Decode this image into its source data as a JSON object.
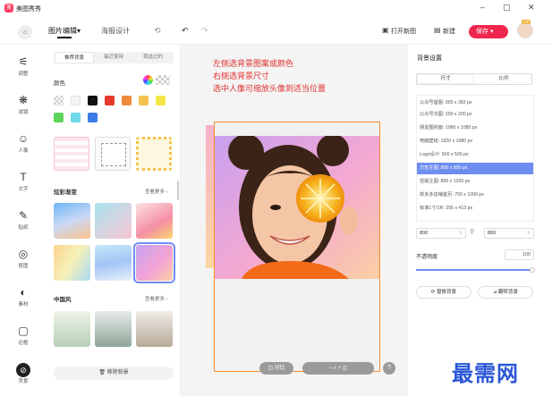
{
  "titlebar": {
    "logo_text": "美",
    "app_title": "美图秀秀",
    "min": "–",
    "max": "▢",
    "close": "✕"
  },
  "toolbar": {
    "home_icon": "⌂",
    "tab_main": "图片编辑▾",
    "tab_poster": "海报设计",
    "history_icon": "⟲",
    "undo_icon": "↶",
    "redo_icon": "↷",
    "open_label": "打开新图",
    "open_icon": "▣",
    "new_label": "新建",
    "new_icon": "▤",
    "save_label": "保存 ▾",
    "vip_badge": "VIP"
  },
  "leftnav": [
    {
      "icon": "⚟",
      "label": "调整"
    },
    {
      "icon": "❋",
      "label": "滤镜"
    },
    {
      "icon": "☺",
      "label": "人像"
    },
    {
      "icon": "T",
      "label": "文字"
    },
    {
      "icon": "✎",
      "label": "贴纸"
    },
    {
      "icon": "◎",
      "label": "抠图"
    },
    {
      "icon": "◐",
      "label": "素材"
    },
    {
      "icon": "▢",
      "label": "边框"
    },
    {
      "icon": "⊘",
      "label": "背景"
    }
  ],
  "panel": {
    "tabs": [
      "推荐背景",
      "最近使用",
      "我选过的"
    ],
    "color_label": "颜色",
    "colors": [
      "#cccccc",
      "#f4f4f4",
      "#111111",
      "#e83a2c",
      "#ef8a3a",
      "#f6c24e",
      "#f5e74a",
      "#5fd35b",
      "#6fd8e9",
      "#3d7ae6"
    ],
    "gradient_title": "炫彩渐变",
    "gradient_more": "查看更多 ›",
    "chinese_title": "中国风",
    "chinese_more": "查看更多 ›",
    "remove_label": "🗑 移除背景"
  },
  "workspace": {
    "instructions": [
      "左侧选背景图案或颜色",
      "右侧选背景尺寸",
      "选中人像可缩放头像到适当位置"
    ],
    "compare_label": "◫ 对比",
    "zoom_controls": "–  ⌕  +  ◫",
    "help_label": "?"
  },
  "rightpanel": {
    "title": "背景设置",
    "tabs": [
      "尺寸",
      "比例"
    ],
    "presets": [
      "公众号首图: 900 x 383 px",
      "公众号次图: 200 x 200 px",
      "朋友圈封面: 1080 x 1080 px",
      "电脑壁纸: 1920 x 1080 px",
      "Logo设计: 500 x 500 px",
      "方形主图: 800 x 800 px",
      "竖版主图: 800 x 1200 px",
      "拼多多店铺首页: 750 x 1000 px",
      "标准1寸/1R: 295 x 413 px"
    ],
    "selected_preset_index": 5,
    "width_value": "800",
    "height_value": "800",
    "unit_icon": "⇳",
    "lock_icon": "⚲",
    "opacity_label": "不透明度",
    "opacity_value": "100",
    "opacity_fraction": 1.0,
    "replace_label": "⟳ 替换背景",
    "flip_label": "⊿ 翻转背景",
    "accent": "#6d8df0"
  },
  "watermark": "最需网"
}
